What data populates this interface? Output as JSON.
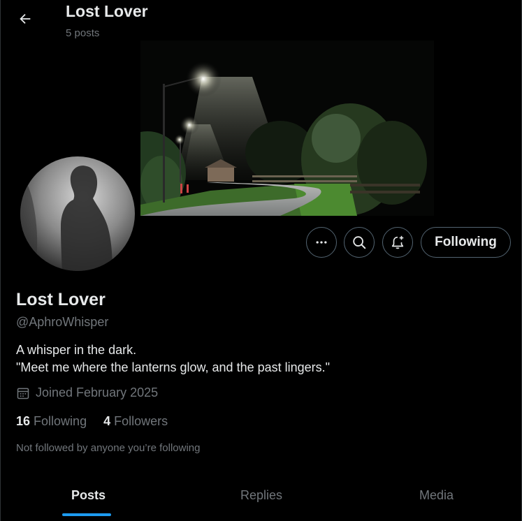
{
  "header": {
    "title": "Lost Lover",
    "post_count": "5 posts"
  },
  "profile": {
    "display_name": "Lost Lover",
    "handle": "@AphroWhisper",
    "bio_line1": "A whisper in the dark.",
    "bio_line2": "\"Meet me where the lanterns glow, and the past lingers.\"",
    "joined": "Joined February 2025",
    "following_count": "16",
    "following_label": "Following",
    "followers_count": "4",
    "followers_label": "Followers",
    "not_followed": "Not followed by anyone you’re following"
  },
  "actions": {
    "more_icon": "more-icon",
    "search_icon": "search-icon",
    "notify_icon": "bell-plus-icon",
    "follow_label": "Following"
  },
  "tabs": [
    {
      "label": "Posts",
      "active": true
    },
    {
      "label": "Replies",
      "active": false
    },
    {
      "label": "Media",
      "active": false
    }
  ],
  "colors": {
    "accent": "#1d9bf0",
    "muted_text": "#71767b",
    "border": "#536471"
  }
}
